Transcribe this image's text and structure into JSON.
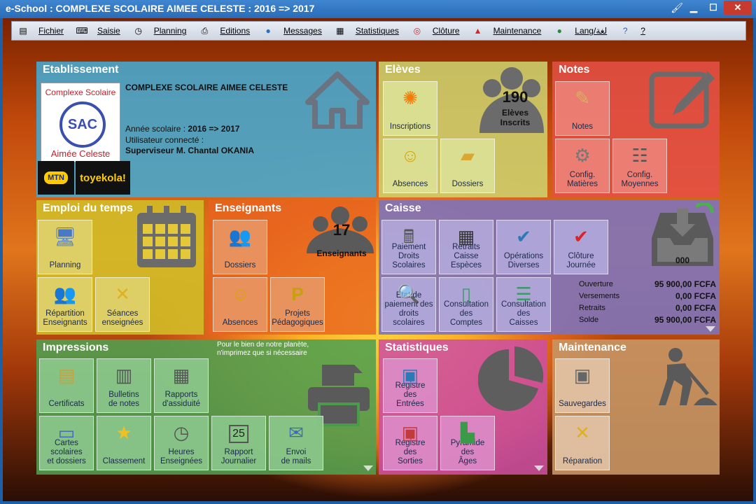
{
  "window": {
    "title": "e-School : COMPLEXE SCOLAIRE AIMEE CELESTE : 2016 => 2017"
  },
  "menu": [
    {
      "label": "Fichier",
      "icon": "file-icon"
    },
    {
      "label": "Saisie",
      "icon": "keyboard-icon"
    },
    {
      "label": "Planning",
      "icon": "clock-icon"
    },
    {
      "label": "Editions",
      "icon": "print-icon"
    },
    {
      "label": "Messages",
      "icon": "message-icon"
    },
    {
      "label": "Statistiques",
      "icon": "chart-icon"
    },
    {
      "label": "Clôture",
      "icon": "lock-icon"
    },
    {
      "label": "Maintenance",
      "icon": "warning-icon"
    },
    {
      "label": "Lang/لغة",
      "icon": "globe-icon"
    },
    {
      "label": "?",
      "icon": "help-icon"
    }
  ],
  "etablissement": {
    "title": "Etablissement",
    "school_name": "COMPLEXE SCOLAIRE AIMEE CELESTE",
    "year_label": "Année scolaire : ",
    "year_value": "2016 => 2017",
    "user_label": "Utilisateur connecté :",
    "user_value": "Superviseur M. Chantal OKANIA",
    "logo_line1": "Complexe Scolaire",
    "logo_mark": "SAC",
    "logo_line2": "Aimée Celeste",
    "sponsor1": "MTN",
    "sponsor2": "toyekola!"
  },
  "eleves": {
    "title": "Elèves",
    "count": "190",
    "count_label": "Elèves\nInscrits",
    "tiles": [
      "Inscriptions",
      "Absences",
      "Dossiers"
    ]
  },
  "notes": {
    "title": "Notes",
    "tiles": [
      "Notes",
      "Config.\nMatières",
      "Config.\nMoyennes"
    ]
  },
  "emploi": {
    "title": "Emploi du temps",
    "tiles": [
      "Planning",
      "Répartition\nEnseignants",
      "Séances\nenseignées"
    ]
  },
  "enseignants": {
    "title": "Enseignants",
    "count": "17",
    "count_label": "Enseignants",
    "tiles": [
      "Dossiers",
      "Absences",
      "Projets\nPédagogiques"
    ]
  },
  "caisse": {
    "title": "Caisse",
    "tiles": [
      "Paiement\nDroits\nScolaires",
      "Retraits\nCaisse\nEspèces",
      "Opérations\nDiverses",
      "Clôture\nJournée",
      "Etat de\npaiement des\ndroits scolaires",
      "Consultation\ndes\nComptes",
      "Consultation\ndes\nCaisses"
    ],
    "counter": "000",
    "rows": [
      {
        "label": "Ouverture",
        "value": "95 900,00 FCFA"
      },
      {
        "label": "Versements",
        "value": "0,00 FCFA"
      },
      {
        "label": "Retraits",
        "value": "0,00 FCFA"
      },
      {
        "label": "Solde",
        "value": "95 900,00 FCFA"
      }
    ]
  },
  "impressions": {
    "title": "Impressions",
    "note": "Pour le bien de notre planète,\nn'imprimez que si nécessaire",
    "tiles": [
      "Certificats",
      "Bulletins\nde notes",
      "Rapports\nd'assiduité",
      "Cartes\nscolaires\net dossiers",
      "Classement",
      "Heures\nEnseignées",
      "Rapport\nJournalier",
      "Envoi\nde mails"
    ],
    "calendar_day": "25"
  },
  "statistiques": {
    "title": "Statistiques",
    "tiles": [
      "Registre\ndes\nEntrées",
      "Registre\ndes\nSorties",
      "Pyramide\ndes\nÂges"
    ]
  },
  "maintenance": {
    "title": "Maintenance",
    "tiles": [
      "Sauvegardes",
      "Réparation"
    ]
  }
}
